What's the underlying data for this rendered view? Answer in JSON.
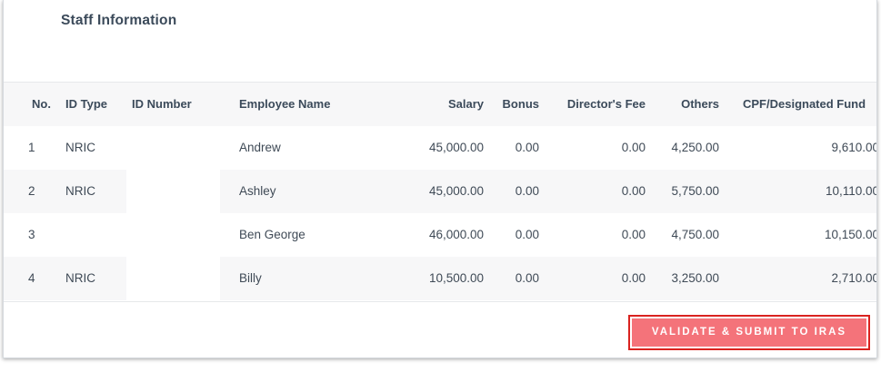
{
  "section": {
    "title": "Staff Information"
  },
  "table": {
    "headers": {
      "no": "No.",
      "id_type": "ID Type",
      "id_number": "ID Number",
      "employee_name": "Employee Name",
      "salary": "Salary",
      "bonus": "Bonus",
      "directors_fee": "Director's Fee",
      "others": "Others",
      "cpf": "CPF/Designated Fund"
    },
    "rows": [
      {
        "no": "1",
        "id_type": "NRIC",
        "id_number": "",
        "employee_name": "Andrew",
        "salary": "45,000.00",
        "bonus": "0.00",
        "directors_fee": "0.00",
        "others": "4,250.00",
        "cpf": "9,610.00"
      },
      {
        "no": "2",
        "id_type": "NRIC",
        "id_number": "",
        "employee_name": "Ashley",
        "salary": "45,000.00",
        "bonus": "0.00",
        "directors_fee": "0.00",
        "others": "5,750.00",
        "cpf": "10,110.00"
      },
      {
        "no": "3",
        "id_type": "",
        "id_number": "",
        "employee_name": "Ben George",
        "salary": "46,000.00",
        "bonus": "0.00",
        "directors_fee": "0.00",
        "others": "4,750.00",
        "cpf": "10,150.00"
      },
      {
        "no": "4",
        "id_type": "NRIC",
        "id_number": "",
        "employee_name": "Billy",
        "salary": "10,500.00",
        "bonus": "0.00",
        "directors_fee": "0.00",
        "others": "3,250.00",
        "cpf": "2,710.00"
      }
    ]
  },
  "actions": {
    "submit_label": "VALIDATE & SUBMIT TO IRAS"
  },
  "colors": {
    "button_bg": "#f4737a",
    "button_outline": "#d9221f",
    "row_alt_bg": "#f7f7f8",
    "text": "#3f4a56"
  }
}
